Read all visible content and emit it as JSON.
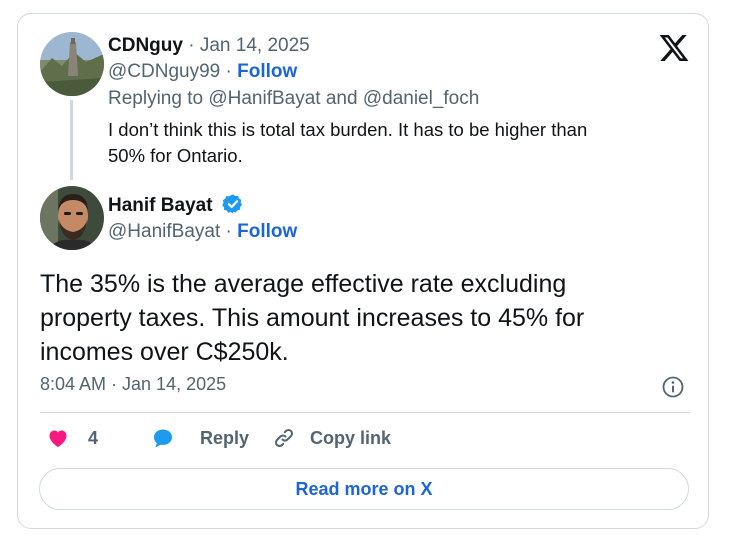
{
  "reply_tweet": {
    "author_name": "CDNguy",
    "date": "Jan 14, 2025",
    "handle": "@CDNguy99",
    "follow_label": "Follow",
    "replying_prefix": "Replying to",
    "replying_to_1": "@HanifBayat",
    "replying_and": "and",
    "replying_to_2": "@daniel_foch",
    "text_line1": "I don’t think this is total tax burden.  It has to be higher than",
    "text_line2": "50% for Ontario."
  },
  "main_tweet": {
    "author_name": "Hanif Bayat",
    "handle": "@HanifBayat",
    "follow_label": "Follow",
    "text_line1": "The 35% is the average effective rate excluding",
    "text_line2": "property taxes. This amount increases to 45% for",
    "text_line3": "incomes over C$250k.",
    "timestamp": "8:04 AM · Jan 14, 2025",
    "verified": true
  },
  "actions": {
    "like_count": "4",
    "reply_label": "Reply",
    "copy_link_label": "Copy link"
  },
  "footer": {
    "read_more_label": "Read more on X"
  },
  "colors": {
    "accent": "#1d64d6",
    "like": "#f91880",
    "reply_icon": "#1d9bf0",
    "verified": "#1d9bf0",
    "muted": "#536471"
  }
}
